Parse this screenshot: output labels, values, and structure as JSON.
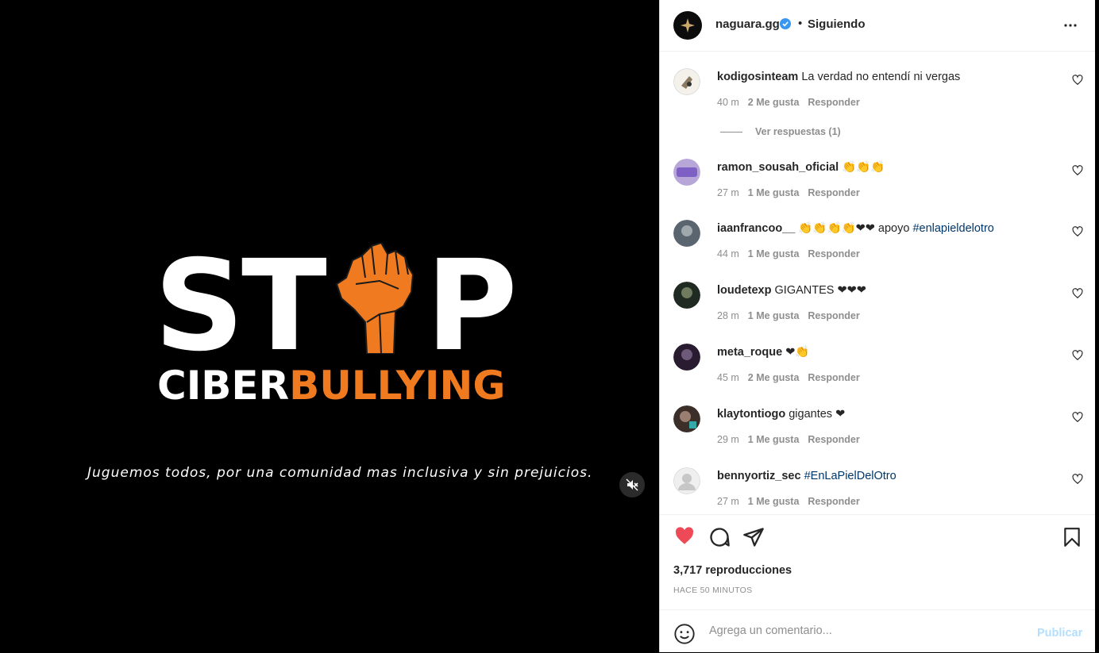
{
  "media": {
    "stop_s": "S",
    "stop_t": "T",
    "stop_p": "P",
    "ciber_white": "CIBER",
    "ciber_orange": "BULLYING",
    "tagline": "Juguemos todos, por una comunidad mas inclusiva y sin prejuicios.",
    "mute_icon": "muted-speaker-icon",
    "accent_color": "#f07a1f"
  },
  "header": {
    "username": "naguara.gg",
    "separator": "•",
    "follow_status": "Siguiendo"
  },
  "comments": [
    {
      "user": "kodigosinteam",
      "text": "La verdad no entendí ni vergas",
      "emoji": "",
      "tag": "",
      "time": "40 m",
      "likes": "2 Me gusta",
      "reply": "Responder"
    },
    {
      "user": "ramon_sousah_oficial",
      "text": "",
      "emoji": "👏👏👏",
      "tag": "",
      "time": "27 m",
      "likes": "1 Me gusta",
      "reply": "Responder"
    },
    {
      "user": "iaanfrancoo__",
      "text": "",
      "emoji": "👏👏👏👏❤❤",
      "text2": "apoyo",
      "tag": "#enlapieldelotro",
      "time": "44 m",
      "likes": "1 Me gusta",
      "reply": "Responder"
    },
    {
      "user": "loudetexp",
      "text": "GIGANTES",
      "emoji": "❤❤❤",
      "tag": "",
      "time": "28 m",
      "likes": "1 Me gusta",
      "reply": "Responder"
    },
    {
      "user": "meta_roque",
      "text": "",
      "emoji": "❤👏",
      "tag": "",
      "time": "45 m",
      "likes": "2 Me gusta",
      "reply": "Responder"
    },
    {
      "user": "klaytontiogo",
      "text": "gigantes",
      "emoji": "❤",
      "tag": "",
      "time": "29 m",
      "likes": "1 Me gusta",
      "reply": "Responder"
    },
    {
      "user": "bennyortiz_sec",
      "text": "",
      "emoji": "",
      "tag": "#EnLaPielDelOtro",
      "time": "27 m",
      "likes": "1 Me gusta",
      "reply": "Responder"
    }
  ],
  "replies_link": "Ver respuestas (1)",
  "actions": {
    "views": "3,717 reproducciones",
    "time_ago": "HACE 50 MINUTOS"
  },
  "add_comment": {
    "placeholder": "Agrega un comentario...",
    "publish_label": "Publicar"
  }
}
